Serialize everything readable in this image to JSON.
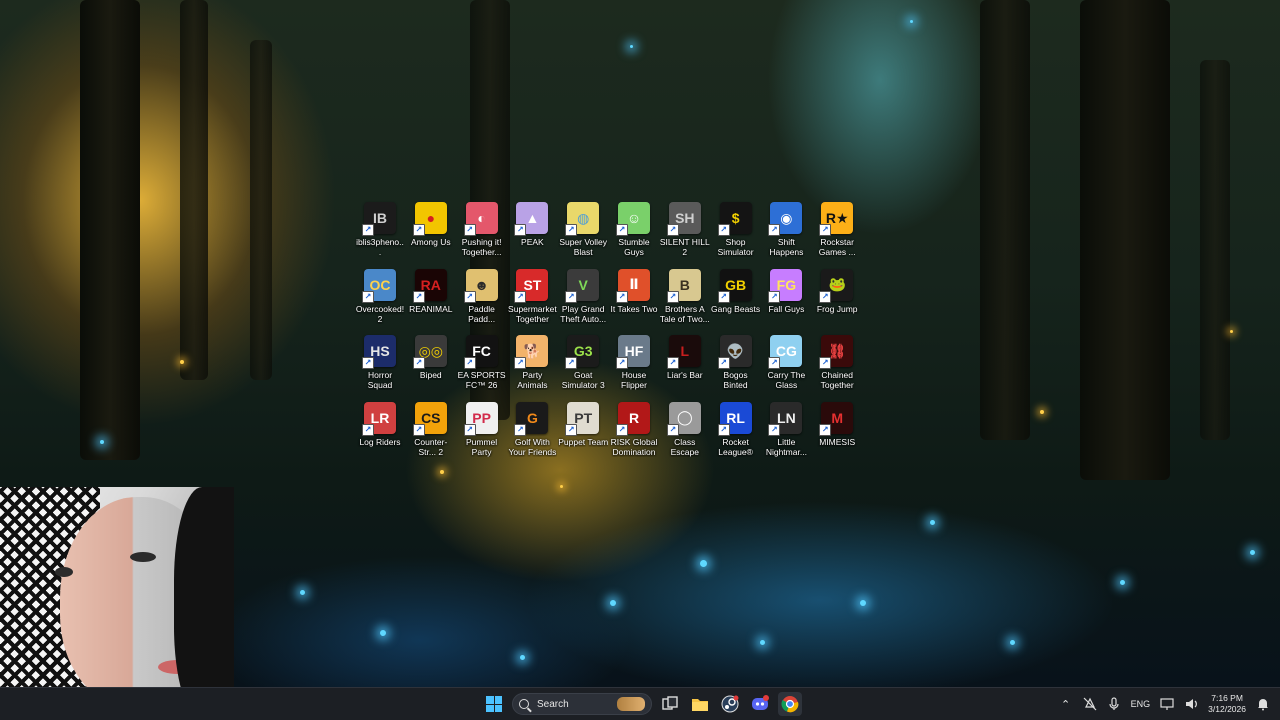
{
  "desktop": {
    "icons": [
      {
        "label": "iblis3pheno...",
        "name": "iblis3phenomenon-shortcut",
        "bg": "#1b1b1b",
        "fg": "#cfcfcf",
        "glyph": "IB"
      },
      {
        "label": "Among Us",
        "name": "among-us-shortcut",
        "bg": "#f2c500",
        "fg": "#d61f1f",
        "glyph": "●"
      },
      {
        "label": "Pushing it! Together...",
        "name": "pushing-it-together-shortcut",
        "bg": "#e4576b",
        "fg": "#ffffff",
        "glyph": "◐"
      },
      {
        "label": "PEAK",
        "name": "peak-shortcut",
        "bg": "#b9a2e6",
        "fg": "#ffffff",
        "glyph": "▲"
      },
      {
        "label": "Super Volley Blast",
        "name": "super-volley-blast-shortcut",
        "bg": "#e9d86a",
        "fg": "#4a9cd9",
        "glyph": "◍"
      },
      {
        "label": "Stumble Guys",
        "name": "stumble-guys-shortcut",
        "bg": "#7ad06a",
        "fg": "#ffffff",
        "glyph": "☺"
      },
      {
        "label": "SILENT HILL 2",
        "name": "silent-hill-2-shortcut",
        "bg": "#5a5a5a",
        "fg": "#d0d0d0",
        "glyph": "SH"
      },
      {
        "label": "Shop Simulator",
        "name": "shop-simulator-shortcut",
        "bg": "#141414",
        "fg": "#f2d000",
        "glyph": "$"
      },
      {
        "label": "Shift Happens",
        "name": "shift-happens-shortcut",
        "bg": "#2d6fd6",
        "fg": "#ffffff",
        "glyph": "◉"
      },
      {
        "label": "Rockstar Games ...",
        "name": "rockstar-games-shortcut",
        "bg": "#fcaf17",
        "fg": "#111111",
        "glyph": "R★"
      },
      {
        "label": "Overcooked! 2",
        "name": "overcooked-2-shortcut",
        "bg": "#4a88c9",
        "fg": "#ffd24a",
        "glyph": "OC"
      },
      {
        "label": "REANIMAL",
        "name": "reanimal-shortcut",
        "bg": "#1a0505",
        "fg": "#d62020",
        "glyph": "RA"
      },
      {
        "label": "Paddle Padd...",
        "name": "paddle-paddle-shortcut",
        "bg": "#e0c070",
        "fg": "#2b2b2b",
        "glyph": "☻"
      },
      {
        "label": "Supermarket Together",
        "name": "supermarket-together-shortcut",
        "bg": "#d82a2a",
        "fg": "#ffffff",
        "glyph": "ST"
      },
      {
        "label": "Play Grand Theft Auto...",
        "name": "play-gta-shortcut",
        "bg": "#3b3b3b",
        "fg": "#7ed957",
        "glyph": "V"
      },
      {
        "label": "It Takes Two",
        "name": "it-takes-two-shortcut",
        "bg": "#e0502a",
        "fg": "#ffffff",
        "glyph": "Ⅱ"
      },
      {
        "label": "Brothers A Tale of Two...",
        "name": "brothers-a-tale-of-two-sons-shortcut",
        "bg": "#d8c890",
        "fg": "#3a3020",
        "glyph": "B"
      },
      {
        "label": "Gang Beasts",
        "name": "gang-beasts-shortcut",
        "bg": "#111111",
        "fg": "#f2d000",
        "glyph": "GB"
      },
      {
        "label": "Fall Guys",
        "name": "fall-guys-shortcut",
        "bg": "#c77dff",
        "fg": "#ffe45c",
        "glyph": "FG"
      },
      {
        "label": "Frog Jump",
        "name": "frog-jump-shortcut",
        "bg": "#1a1a1a",
        "fg": "#5ddc3a",
        "glyph": "🐸"
      },
      {
        "label": "Horror Squad",
        "name": "horror-squad-shortcut",
        "bg": "#1c2c6a",
        "fg": "#e6e6e6",
        "glyph": "HS"
      },
      {
        "label": "Biped",
        "name": "biped-shortcut",
        "bg": "#3a3a3a",
        "fg": "#f2d000",
        "glyph": "◎◎"
      },
      {
        "label": "EA SPORTS FC™ 26",
        "name": "ea-sports-fc-26-shortcut",
        "bg": "#121212",
        "fg": "#ffffff",
        "glyph": "FC"
      },
      {
        "label": "Party Animals",
        "name": "party-animals-shortcut",
        "bg": "#f2b36a",
        "fg": "#ffffff",
        "glyph": "🐕"
      },
      {
        "label": "Goat Simulator 3",
        "name": "goat-simulator-3-shortcut",
        "bg": "#1b1b1b",
        "fg": "#9be04a",
        "glyph": "G3"
      },
      {
        "label": "House Flipper",
        "name": "house-flipper-shortcut",
        "bg": "#6a7a8a",
        "fg": "#ffffff",
        "glyph": "HF"
      },
      {
        "label": "Liar's Bar",
        "name": "liars-bar-shortcut",
        "bg": "#1a0b0b",
        "fg": "#c81e1e",
        "glyph": "L"
      },
      {
        "label": "Bogos Binted",
        "name": "bogos-binted-shortcut",
        "bg": "#2a2a2a",
        "fg": "#7ed957",
        "glyph": "👽"
      },
      {
        "label": "Carry The Glass",
        "name": "carry-the-glass-shortcut",
        "bg": "#8fd0f0",
        "fg": "#ffffff",
        "glyph": "CG"
      },
      {
        "label": "Chained Together",
        "name": "chained-together-shortcut",
        "bg": "#3a0a0a",
        "fg": "#e64040",
        "glyph": "⛓"
      },
      {
        "label": "Log Riders",
        "name": "log-riders-shortcut",
        "bg": "#d04040",
        "fg": "#ffffff",
        "glyph": "LR"
      },
      {
        "label": "Counter-Str... 2",
        "name": "counter-strike-2-shortcut",
        "bg": "#f2a20a",
        "fg": "#1a1a1a",
        "glyph": "CS"
      },
      {
        "label": "Pummel Party",
        "name": "pummel-party-shortcut",
        "bg": "#f0f0f0",
        "fg": "#d22a4a",
        "glyph": "PP"
      },
      {
        "label": "Golf With Your Friends",
        "name": "golf-with-your-friends-shortcut",
        "bg": "#1a1a1a",
        "fg": "#f28a1a",
        "glyph": "G"
      },
      {
        "label": "Puppet Team",
        "name": "puppet-team-shortcut",
        "bg": "#e0dcd0",
        "fg": "#3a3a3a",
        "glyph": "PT"
      },
      {
        "label": "RISK Global Domination",
        "name": "risk-global-domination-shortcut",
        "bg": "#b21818",
        "fg": "#ffffff",
        "glyph": "R"
      },
      {
        "label": "Class Escape",
        "name": "class-escape-shortcut",
        "bg": "#9a9a9a",
        "fg": "#ffffff",
        "glyph": "◯"
      },
      {
        "label": "Rocket League®",
        "name": "rocket-league-shortcut",
        "bg": "#1a4ad6",
        "fg": "#ffffff",
        "glyph": "RL"
      },
      {
        "label": "Little Nightmar...",
        "name": "little-nightmares-shortcut",
        "bg": "#2a2a2a",
        "fg": "#f0f0f0",
        "glyph": "LN"
      },
      {
        "label": "MIMESIS",
        "name": "mimesis-shortcut",
        "bg": "#2a0a0a",
        "fg": "#e63030",
        "glyph": "M"
      }
    ]
  },
  "taskbar": {
    "search_label": "Search",
    "language": "ENG",
    "time": "7:16 PM",
    "date": "3/12/2026"
  }
}
